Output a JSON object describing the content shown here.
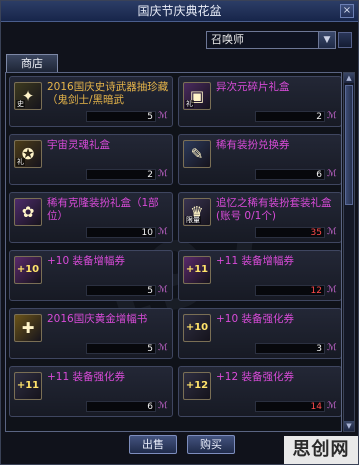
{
  "window": {
    "title": "国庆节庆典花盆",
    "close": "×"
  },
  "filter": {
    "selected": "召唤师",
    "arrow": "▼"
  },
  "tabs": [
    {
      "label": "商店"
    }
  ],
  "items": [
    {
      "name": "2016国庆史诗武器抽珍藏（鬼剑士/黑暗武",
      "price": "5",
      "color": "gold",
      "icon_bg": "#3d3a1e",
      "icon_glyph": "✦",
      "icon_tag": "史",
      "icon_name": "epic-weapon-box-icon"
    },
    {
      "name": "异次元碎片礼盒",
      "price": "2",
      "color": "purple",
      "icon_bg": "#4a2a5e",
      "icon_glyph": "▣",
      "icon_tag": "礼",
      "icon_name": "dimension-fragment-box-icon"
    },
    {
      "name": "宇宙灵魂礼盒",
      "price": "2",
      "color": "purple",
      "icon_bg": "#4d3d18",
      "icon_glyph": "✪",
      "icon_tag": "礼",
      "icon_name": "cosmic-soul-box-icon"
    },
    {
      "name": "稀有装扮兑换券",
      "price": "6",
      "color": "purple",
      "icon_bg": "#2c3a5a",
      "icon_glyph": "✎",
      "icon_tag": "",
      "icon_name": "rare-avatar-ticket-icon"
    },
    {
      "name": "稀有克隆装扮礼盒（1部位）",
      "price": "10",
      "color": "purple",
      "icon_bg": "#4e2b6b",
      "icon_glyph": "✿",
      "icon_tag": "",
      "icon_name": "rare-clone-avatar-box-icon"
    },
    {
      "name": "追忆之稀有装扮套装礼盒(账号 0/1个)",
      "price": "35",
      "color": "purple",
      "price_color": "red",
      "icon_bg": "#3a3450",
      "icon_glyph": "♛",
      "icon_tag": "限量",
      "icon_name": "memory-avatar-set-box-icon"
    },
    {
      "name": "+10 装备增幅券",
      "price": "5",
      "color": "purple",
      "icon_bg": "#5a2a6a",
      "icon_glyph": "+10",
      "icon_tag": "",
      "icon_name": "amplify-ticket-10-icon"
    },
    {
      "name": "+11 装备增幅券",
      "price": "12",
      "color": "purple",
      "price_color": "red",
      "icon_bg": "#5a2a6a",
      "icon_glyph": "+11",
      "icon_tag": "",
      "icon_name": "amplify-ticket-11-icon"
    },
    {
      "name": "2016国庆黄金增幅书",
      "price": "5",
      "color": "purple",
      "icon_bg": "#6b5418",
      "icon_glyph": "✚",
      "icon_tag": "",
      "icon_name": "gold-amplify-book-icon"
    },
    {
      "name": "+10 装备强化券",
      "price": "3",
      "color": "purple",
      "icon_bg": "#2e2e40",
      "icon_glyph": "+10",
      "icon_tag": "",
      "icon_name": "reinforce-ticket-10-icon"
    },
    {
      "name": "+11 装备强化券",
      "price": "6",
      "color": "purple",
      "icon_bg": "#2e2e40",
      "icon_glyph": "+11",
      "icon_tag": "",
      "icon_name": "reinforce-ticket-11-icon"
    },
    {
      "name": "+12 装备强化券",
      "price": "14",
      "color": "purple",
      "price_color": "red",
      "icon_bg": "#2e2e40",
      "icon_glyph": "+12",
      "icon_tag": "",
      "icon_name": "reinforce-ticket-12-icon"
    }
  ],
  "buttons": {
    "sell": "出售",
    "buy": "购买"
  },
  "logo": "思创网",
  "currency_symbol": "ℳ"
}
